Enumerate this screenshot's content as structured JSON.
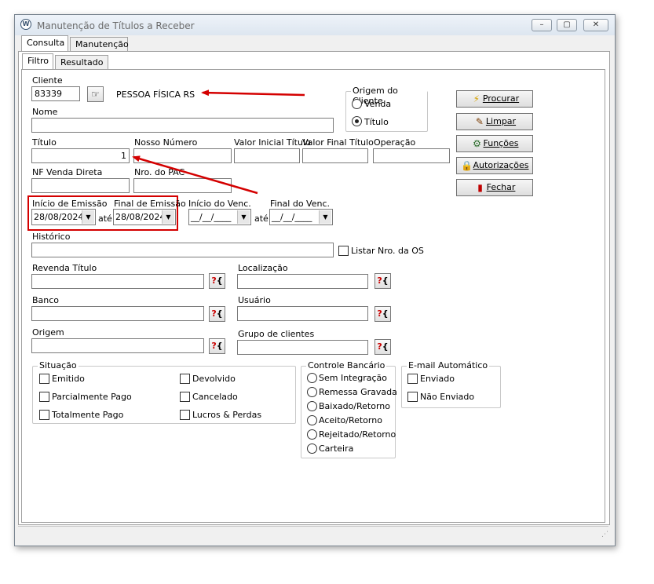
{
  "window": {
    "title": "Manutenção de Títulos a Receber",
    "icon": "vw-logo-icon"
  },
  "tabs": [
    "Consulta",
    "Manutenção"
  ],
  "subtabs": [
    "Filtro",
    "Resultado"
  ],
  "cliente": {
    "label": "Cliente",
    "value": "83339",
    "name": "PESSOA FÍSICA  RS"
  },
  "origem_cliente": {
    "title": "Origem do Cliente",
    "options": [
      "Venda",
      "Título"
    ],
    "selected": "Título"
  },
  "fields": {
    "nome": "Nome",
    "titulo": "Título",
    "titulo_value": "1",
    "nosso_numero": "Nosso Número",
    "valor_inicial": "Valor Inicial Título",
    "valor_final": "Valor Final Título",
    "operacao": "Operação",
    "nf_venda_direta": "NF Venda Direta",
    "nro_pac": "Nro. do PAC",
    "inicio_emissao": "Início de Emissão",
    "final_emissao": "Final de Emissão",
    "inicio_emissao_value": "28/08/2024",
    "final_emissao_value": "28/08/2024",
    "ate": "até",
    "inicio_venc": "Início do Venc.",
    "final_venc": "Final do Venc.",
    "venc_placeholder": "__/__/____",
    "historico": "Histórico",
    "listar_os": "Listar Nro. da OS",
    "revenda_titulo": "Revenda Título",
    "localizacao": "Localização",
    "banco": "Banco",
    "usuario": "Usuário",
    "origem": "Origem",
    "grupo_clientes": "Grupo de clientes"
  },
  "buttons": {
    "procurar": "Procurar",
    "limpar": "Limpar",
    "funcoes": "Funções",
    "autorizacoes": "Autorizações",
    "fechar": "Fechar"
  },
  "situacao": {
    "title": "Situação",
    "items": [
      "Emitido",
      "Devolvido",
      "Parcialmente Pago",
      "Cancelado",
      "Totalmente Pago",
      "Lucros & Perdas"
    ]
  },
  "controle_bancario": {
    "title": "Controle Bancário",
    "items": [
      "Sem Integração",
      "Remessa Gravada",
      "Baixado/Retorno",
      "Aceito/Retorno",
      "Rejeitado/Retorno",
      "Carteira"
    ]
  },
  "email_automatico": {
    "title": "E-mail Automático",
    "items": [
      "Enviado",
      "Não Enviado"
    ]
  },
  "lookup_symbol": "?",
  "lookup_bracket": "{",
  "colors": {
    "annotation_red": "#d40000",
    "accent": "#d40000"
  }
}
